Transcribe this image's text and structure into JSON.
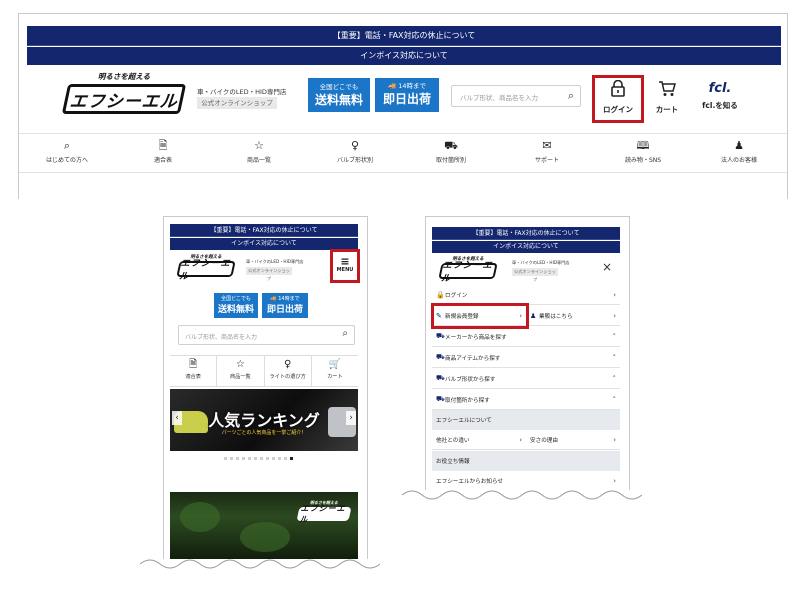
{
  "desktop": {
    "notice_1": "【重要】電話・FAX対応の休止について",
    "notice_2": "インボイス対応について",
    "logo_tagline": "明るさを超える",
    "logo_text": "エフシーエル",
    "shop_desc": "車・バイクのLED・HID専門店",
    "shop_tag": "公式オンラインショップ",
    "promo_shipping": {
      "small": "全国どこでも",
      "big": "送料無料"
    },
    "promo_sameday": {
      "small": "14時まで",
      "big": "即日出荷"
    },
    "search_placeholder": "バルブ形状、商品名を入力",
    "login_label": "ログイン",
    "cart_label": "カート",
    "brand_mark": "fcl.",
    "about_label": "fcl.を知る",
    "nav": [
      {
        "icon": "search-icon",
        "label": "はじめての方へ"
      },
      {
        "icon": "document-icon",
        "label": "適合表"
      },
      {
        "icon": "star-icon",
        "label": "商品一覧"
      },
      {
        "icon": "bulb-icon",
        "label": "バルブ形状別"
      },
      {
        "icon": "car-icon",
        "label": "取付箇所別"
      },
      {
        "icon": "mail-icon",
        "label": "サポート"
      },
      {
        "icon": "book-icon",
        "label": "読み物・SNS"
      },
      {
        "icon": "person-icon",
        "label": "法人のお客様"
      }
    ]
  },
  "mobile_home": {
    "notice_1": "【重要】電話・FAX対応の休止について",
    "notice_2": "インボイス対応について",
    "logo_tagline": "明るさを超える",
    "logo_text": "エフシーエル",
    "shop_desc": "車・バイクのLED・HID専門店",
    "shop_tag": "公式オンラインショップ",
    "menu_label": "MENU",
    "promo_shipping": {
      "small": "全国どこでも",
      "big": "送料無料"
    },
    "promo_sameday": {
      "small": "14時まで",
      "big": "即日出荷"
    },
    "search_placeholder": "バルブ形状、商品名を入力",
    "icons": [
      {
        "icon": "document-icon",
        "label": "適合表"
      },
      {
        "icon": "star-icon",
        "label": "商品一覧"
      },
      {
        "icon": "bulb-icon",
        "label": "ライトの選び方"
      },
      {
        "icon": "cart-icon",
        "label": "カート"
      }
    ],
    "banner_title": "人気ランキング",
    "banner_sub": "パーツごとの人気商品を一挙ご紹介！",
    "slide_count": 12,
    "slide_active": 12,
    "logo2_tagline": "明るさを超える",
    "logo2_text": "エフシーエル"
  },
  "mobile_menu": {
    "notice_1": "【重要】電話・FAX対応の休止について",
    "notice_2": "インボイス対応について",
    "logo_tagline": "明るさを超える",
    "logo_text": "エフシーエル",
    "shop_desc": "車・バイクのLED・HID専門店",
    "shop_tag": "公式オンラインショップ",
    "close_glyph": "×",
    "login": "ログイン",
    "register": "新規会員登録",
    "business": "業販はこちら",
    "maker_search": "メーカーから商品を探す",
    "item_search": "商品アイテムから探す",
    "bulb_search": "バルブ形状から探す",
    "mount_search": "取付箇所から探す",
    "about_section": "エフシーエルについて",
    "diff": "他社との違い",
    "cheap": "安さの理由",
    "useful_section": "お役立ち情報",
    "news": "エフシーエルからお知らせ"
  },
  "colors": {
    "navy": "#13266e",
    "blue": "#1c76c8",
    "red": "#c3181f"
  }
}
